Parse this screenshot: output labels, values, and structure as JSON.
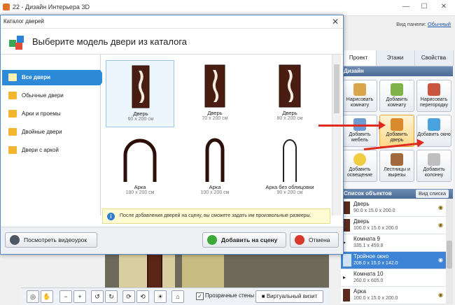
{
  "window": {
    "title": "22 - Дизайн Интерьера 3D"
  },
  "view_panel": {
    "label": "Вид панели:",
    "value": "Обычный"
  },
  "right_tabs": [
    "Проект",
    "Этажи",
    "Свойства"
  ],
  "right_section": "Дизайн",
  "tools": [
    {
      "label": "Нарисовать комнату"
    },
    {
      "label": "Добавить комнату"
    },
    {
      "label": "Нарисовать перегородку"
    },
    {
      "label": "Добавить мебель"
    },
    {
      "label": "Добавить дверь"
    },
    {
      "label": "Добавить окно"
    },
    {
      "label": "Добавить освещение"
    },
    {
      "label": "Лестницы и вырезы"
    },
    {
      "label": "Добавить колонну"
    }
  ],
  "objects_section": {
    "title": "Список объектов",
    "view_btn": "Вид списка"
  },
  "objects": [
    {
      "name": "Дверь",
      "dims": "90.0 x 15.0 x 200.0"
    },
    {
      "name": "Дверь",
      "dims": "100.0 x 15.0 x 200.0"
    },
    {
      "name": "Комната 9",
      "dims": "335.1 x 459.8"
    },
    {
      "name": "Тройное окно",
      "dims": "208.0 x 15.0 x 142.0"
    },
    {
      "name": "Комната 10",
      "dims": "260.0 x 605.0"
    },
    {
      "name": "Арка",
      "dims": "100.0 x 15.0 x 200.0"
    }
  ],
  "bottom": {
    "transparent_walls": "Прозрачные стены",
    "virtual_visit": "Виртуальный визит"
  },
  "dialog": {
    "title": "Каталог дверей",
    "header": "Выберите модель двери из каталога",
    "categories": [
      "Все двери",
      "Обычные двери",
      "Арки и проемы",
      "Двойные двери",
      "Двери с аркой"
    ],
    "items": [
      {
        "name": "Дверь",
        "dims": "60 x 200 см"
      },
      {
        "name": "Дверь",
        "dims": "70 x 200 см"
      },
      {
        "name": "Дверь",
        "dims": "80 x 200 см"
      },
      {
        "name": "Арка",
        "dims": "180 x 200 см"
      },
      {
        "name": "Арка",
        "dims": "100 x 200 см"
      },
      {
        "name": "Арка без облицовки",
        "dims": "90 x 200 см"
      }
    ],
    "hint": "После добавления дверей на сцену, вы сможете задать им произвольные размеры.",
    "video_btn": "Посмотреть видеоурок",
    "add_btn": "Добавить на сцену",
    "cancel_btn": "Отмена"
  }
}
